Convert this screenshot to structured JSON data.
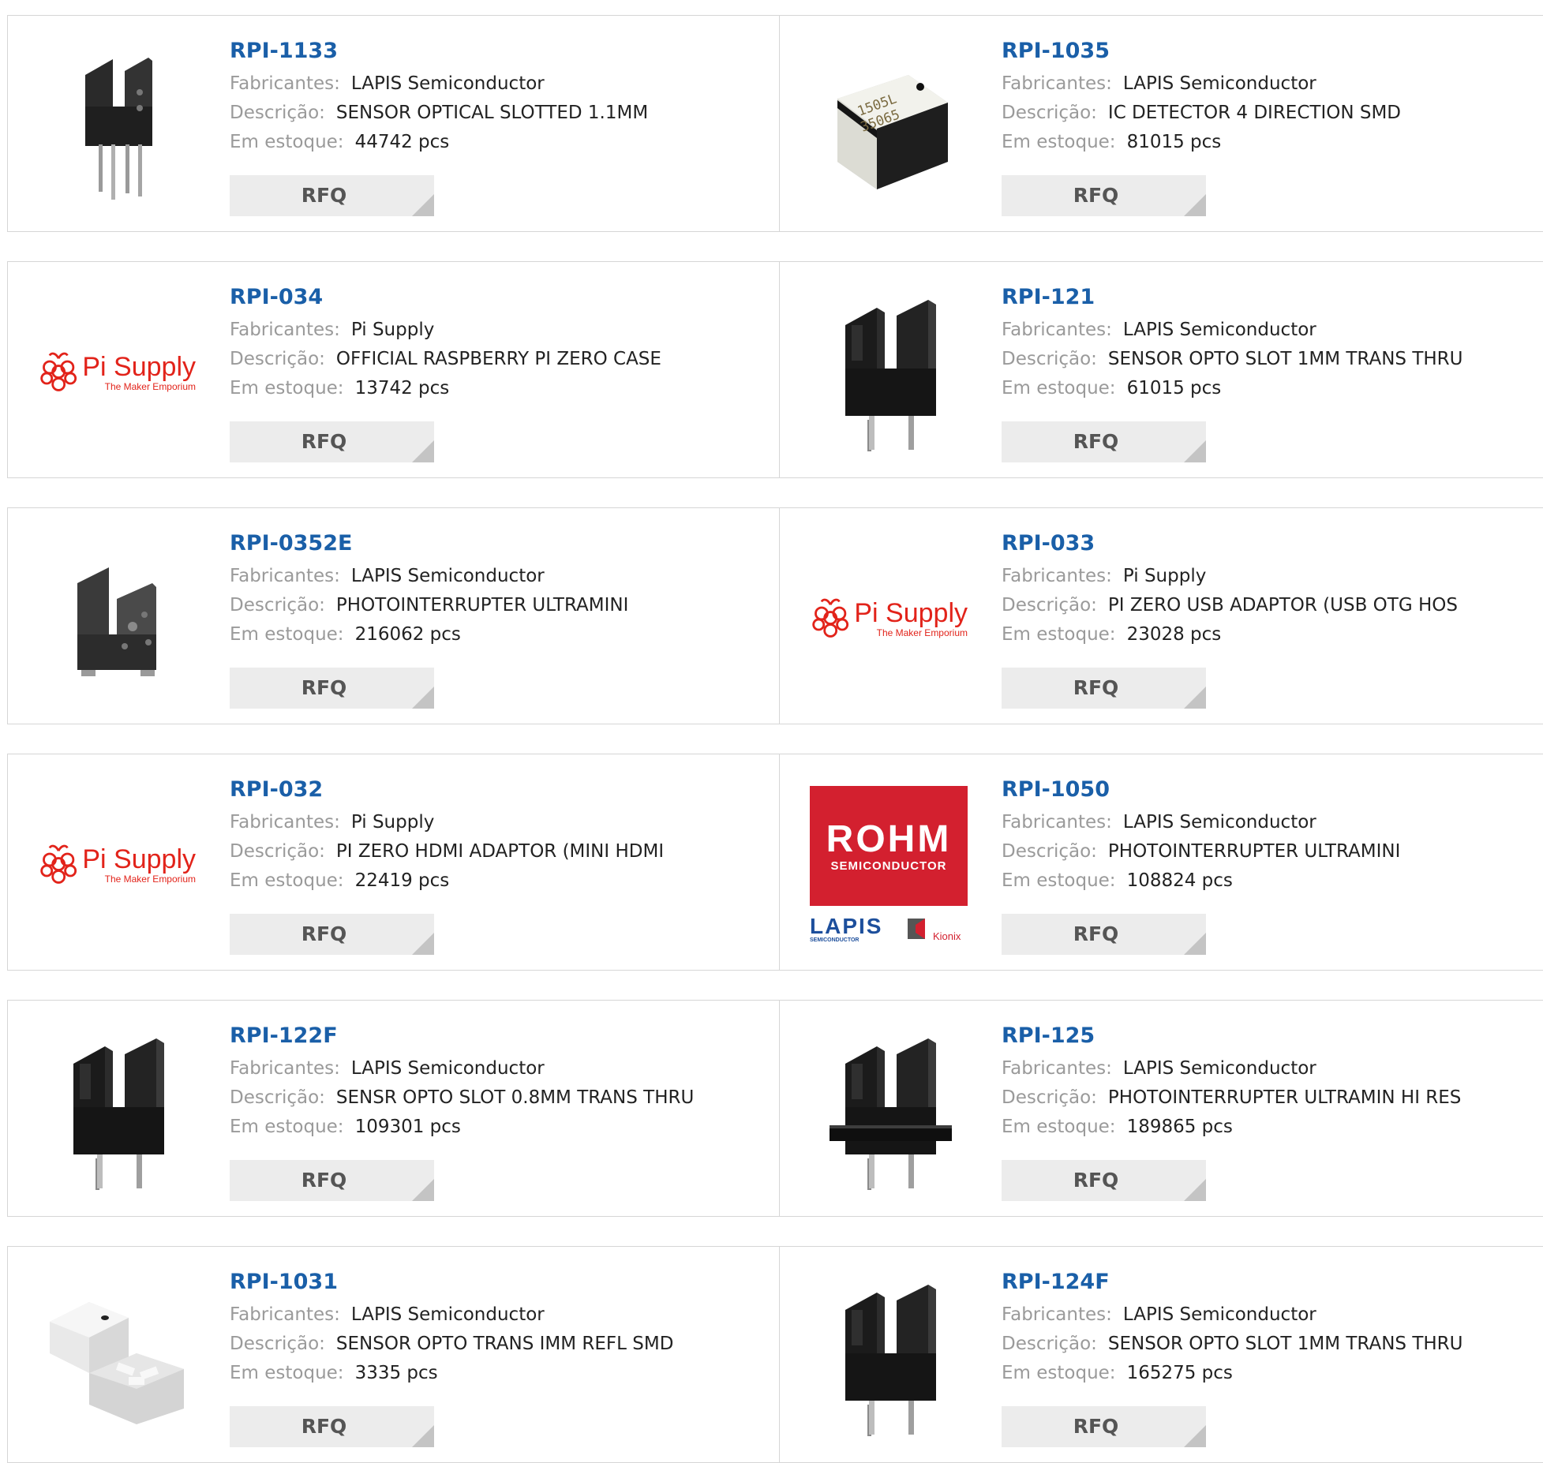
{
  "labels": {
    "manufacturer": "Fabricantes:",
    "description": "Descrição:",
    "stock": "Em estoque:",
    "rfq": "RFQ"
  },
  "products": [
    {
      "pn": "RPI-1133",
      "manufacturer": "LAPIS Semiconductor",
      "description": "SENSOR OPTICAL SLOTTED 1.1MM",
      "stock": "44742 pcs",
      "image": "slotted-sensor-small-icon"
    },
    {
      "pn": "RPI-1035",
      "manufacturer": "LAPIS Semiconductor",
      "description": "IC DETECTOR 4 DIRECTION SMD",
      "stock": "81015 pcs",
      "image": "smd-chip-icon",
      "chip_marking": [
        "1505L",
        "35065"
      ]
    },
    {
      "pn": "RPI-034",
      "manufacturer": "Pi Supply",
      "description": "OFFICIAL RASPBERRY PI ZERO CASE",
      "stock": "13742 pcs",
      "image": "pi-supply-logo",
      "logo_title": "Pi Supply",
      "logo_tagline": "The Maker Emporium"
    },
    {
      "pn": "RPI-121",
      "manufacturer": "LAPIS Semiconductor",
      "description": "SENSOR OPTO SLOT 1MM TRANS THRU",
      "stock": "61015 pcs",
      "image": "slotted-sensor-icon"
    },
    {
      "pn": "RPI-0352E",
      "manufacturer": "LAPIS Semiconductor",
      "description": "PHOTOINTERRUPTER ULTRAMINI",
      "stock": "216062 pcs",
      "image": "ultramini-interrupter-icon"
    },
    {
      "pn": "RPI-033",
      "manufacturer": "Pi Supply",
      "description": "PI ZERO USB ADAPTOR (USB OTG HOS",
      "stock": "23028 pcs",
      "image": "pi-supply-logo",
      "logo_title": "Pi Supply",
      "logo_tagline": "The Maker Emporium"
    },
    {
      "pn": "RPI-032",
      "manufacturer": "Pi Supply",
      "description": "PI ZERO HDMI ADAPTOR (MINI HDMI",
      "stock": "22419 pcs",
      "image": "pi-supply-logo",
      "logo_title": "Pi Supply",
      "logo_tagline": "The Maker Emporium"
    },
    {
      "pn": "RPI-1050",
      "manufacturer": "LAPIS Semiconductor",
      "description": "PHOTOINTERRUPTER ULTRAMINI",
      "stock": "108824 pcs",
      "image": "rohm-lapis-logo",
      "logo_title": "ROHM",
      "logo_sub": "SEMICONDUCTOR",
      "logo_lapis": "LAPIS",
      "logo_lapis_sub": "SEMICONDUCTOR",
      "logo_kionix": "Kionix"
    },
    {
      "pn": "RPI-122F",
      "manufacturer": "LAPIS Semiconductor",
      "description": "SENSR OPTO SLOT 0.8MM TRANS THRU",
      "stock": "109301 pcs",
      "image": "slotted-sensor-icon"
    },
    {
      "pn": "RPI-125",
      "manufacturer": "LAPIS Semiconductor",
      "description": "PHOTOINTERRUPTER ULTRAMIN HI RES",
      "stock": "189865 pcs",
      "image": "flanged-slotted-sensor-icon"
    },
    {
      "pn": "RPI-1031",
      "manufacturer": "LAPIS Semiconductor",
      "description": "SENSOR OPTO TRANS IMM REFL SMD",
      "stock": "3335 pcs",
      "image": "white-smd-sensor-icon"
    },
    {
      "pn": "RPI-124F",
      "manufacturer": "LAPIS Semiconductor",
      "description": "SENSOR OPTO SLOT 1MM TRANS THRU",
      "stock": "165275 pcs",
      "image": "slotted-sensor-icon"
    }
  ],
  "colors": {
    "part_number": "#1a5fa8",
    "pi_supply_red": "#e2231a",
    "rohm_red": "#d3202f",
    "lapis_blue": "#1d4f9c"
  }
}
